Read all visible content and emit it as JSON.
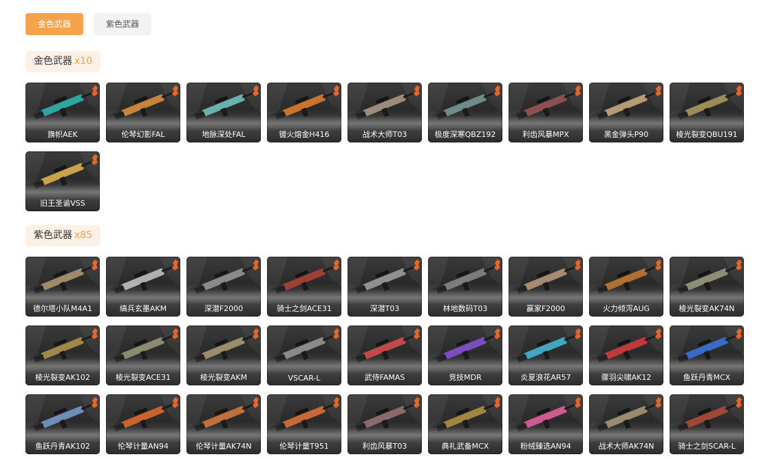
{
  "tabs": [
    {
      "label": "金色武器",
      "active": true
    },
    {
      "label": "紫色武器",
      "active": false
    }
  ],
  "sections": [
    {
      "title": "金色武器",
      "count": "x10",
      "accent": "#f5a24a",
      "items": [
        {
          "name": "旗帜AEK",
          "tint": "#2fa5a0"
        },
        {
          "name": "伦琴幻影FAL",
          "tint": "#c8843c"
        },
        {
          "name": "地脉深处FAL",
          "tint": "#6bb0b0"
        },
        {
          "name": "镀火熔金H416",
          "tint": "#c9742e"
        },
        {
          "name": "战术大师T03",
          "tint": "#9a8b7c"
        },
        {
          "name": "极度深寒QBZ192",
          "tint": "#6e8a8a"
        },
        {
          "name": "利齿风暴MPX",
          "tint": "#8c5050"
        },
        {
          "name": "黑金弹头P90",
          "tint": "#b89a72"
        },
        {
          "name": "棱光裂变QBU191",
          "tint": "#9c8c58"
        },
        {
          "name": "旧王圣谕VSS",
          "tint": "#c9a24a"
        }
      ]
    },
    {
      "title": "紫色武器",
      "count": "x85",
      "accent": "#f5a24a",
      "items": [
        {
          "name": "德尔塔小队M4A1",
          "tint": "#a08a6c"
        },
        {
          "name": "缟兵玄墨AKM",
          "tint": "#b0b0b0"
        },
        {
          "name": "深潜F2000",
          "tint": "#8a8a8a"
        },
        {
          "name": "骑士之剑ACE31",
          "tint": "#a04034"
        },
        {
          "name": "深潜T03",
          "tint": "#909090"
        },
        {
          "name": "林地数码T03",
          "tint": "#7c7c7c"
        },
        {
          "name": "赢家F2000",
          "tint": "#a88a70"
        },
        {
          "name": "火力倾泻AUG",
          "tint": "#b07030"
        },
        {
          "name": "棱光裂变AK74N",
          "tint": "#8e8e76"
        },
        {
          "name": "棱光裂变AK102",
          "tint": "#a08848"
        },
        {
          "name": "棱光裂变ACE31",
          "tint": "#8c8a72"
        },
        {
          "name": "棱光裂变AKM",
          "tint": "#9a8e6a"
        },
        {
          "name": "VSCAR-L",
          "tint": "#8a8a8a"
        },
        {
          "name": "武侍FAMAS",
          "tint": "#c04a4a"
        },
        {
          "name": "竞技MDR",
          "tint": "#7a4ec0"
        },
        {
          "name": "炎夏浪花AR57",
          "tint": "#3fa8c0"
        },
        {
          "name": "骤羽尖啸AK12",
          "tint": "#c03a3a"
        },
        {
          "name": "鱼跃丹青MCX",
          "tint": "#3a6ac8"
        },
        {
          "name": "鱼跃丹青AK102",
          "tint": "#6e8eb8"
        },
        {
          "name": "伦琴计量AN94",
          "tint": "#c8642c"
        },
        {
          "name": "伦琴计量AK74N",
          "tint": "#c07038"
        },
        {
          "name": "伦琴计量T951",
          "tint": "#c86a38"
        },
        {
          "name": "利齿风暴T03",
          "tint": "#8a6a6a"
        },
        {
          "name": "典礼武备MCX",
          "tint": "#a08640"
        },
        {
          "name": "粉绒臻选AN94",
          "tint": "#d05a90"
        },
        {
          "name": "战术大师AK74N",
          "tint": "#9a8a70"
        },
        {
          "name": "骑士之剑SCAR-L",
          "tint": "#a04838"
        }
      ]
    }
  ]
}
